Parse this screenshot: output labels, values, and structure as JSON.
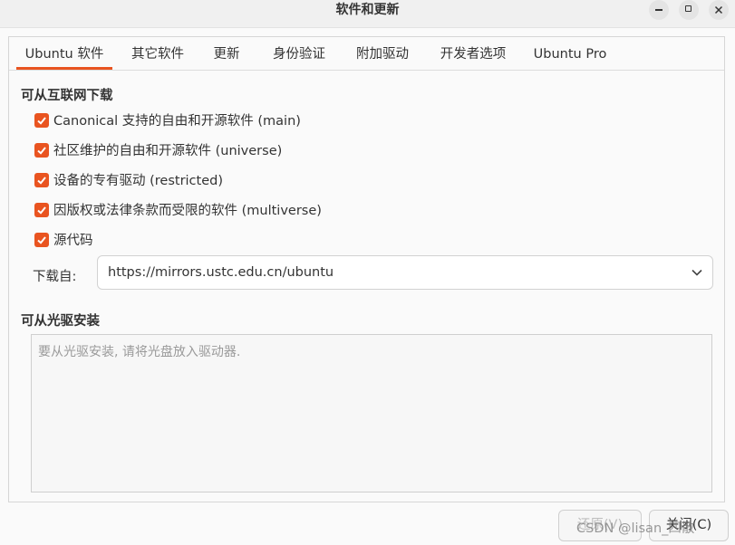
{
  "window": {
    "title": "软件和更新"
  },
  "tabs": [
    {
      "label": "Ubuntu 软件",
      "active": true
    },
    {
      "label": "其它软件",
      "active": false
    },
    {
      "label": "更新",
      "active": false
    },
    {
      "label": "身份验证",
      "active": false
    },
    {
      "label": "附加驱动",
      "active": false
    },
    {
      "label": "开发者选项",
      "active": false
    },
    {
      "label": "Ubuntu Pro",
      "active": false
    }
  ],
  "internet": {
    "section_title": "可从互联网下载",
    "items": [
      {
        "label": "Canonical 支持的自由和开源软件 (main)",
        "checked": true
      },
      {
        "label": "社区维护的自由和开源软件 (universe)",
        "checked": true
      },
      {
        "label": "设备的专有驱动 (restricted)",
        "checked": true
      },
      {
        "label": "因版权或法律条款而受限的软件 (multiverse)",
        "checked": true
      },
      {
        "label": "源代码",
        "checked": true
      }
    ],
    "download_from_label": "下载自:",
    "download_from_value": "https://mirrors.ustc.edu.cn/ubuntu"
  },
  "cdrom": {
    "section_title": "可从光驱安装",
    "placeholder": "要从光驱安装, 请将光盘放入驱动器."
  },
  "buttons": {
    "revert": "还原(V)",
    "close": "关闭(C)"
  },
  "watermark": "CSDN @lisan_四散",
  "colors": {
    "accent": "#e95420",
    "background": "#fafafa"
  }
}
